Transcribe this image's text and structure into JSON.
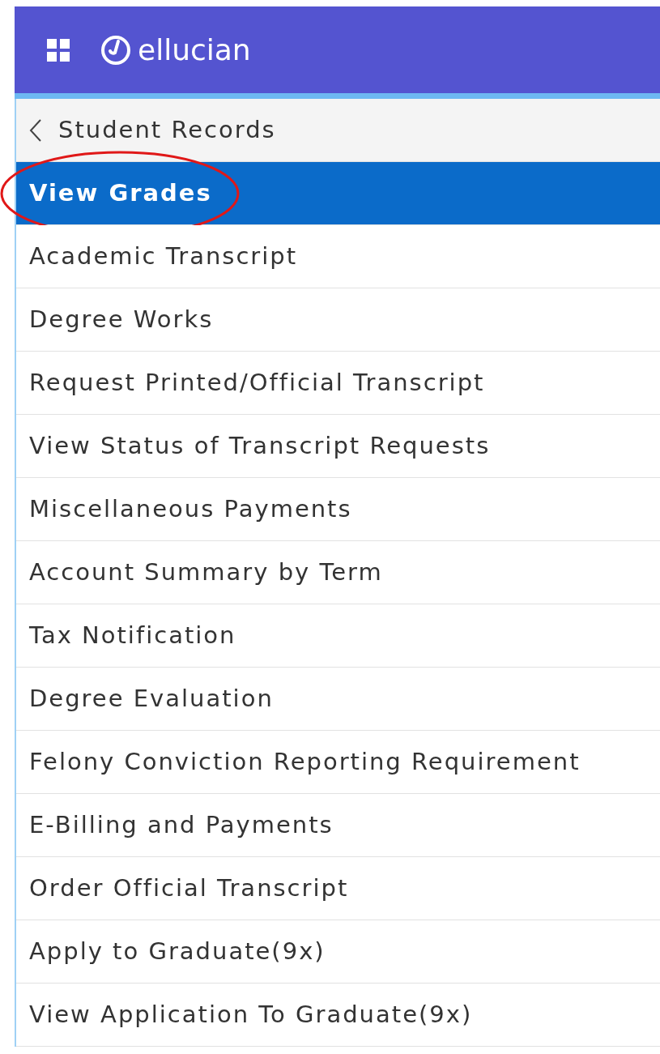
{
  "header": {
    "logo_text": "ellucian"
  },
  "menu": {
    "back_label": "Student Records",
    "items": [
      {
        "label": "View Grades",
        "selected": true,
        "highlighted": true
      },
      {
        "label": "Academic Transcript",
        "selected": false,
        "highlighted": false
      },
      {
        "label": "Degree Works",
        "selected": false,
        "highlighted": false
      },
      {
        "label": "Request Printed/Official Transcript",
        "selected": false,
        "highlighted": false
      },
      {
        "label": "View Status of Transcript Requests",
        "selected": false,
        "highlighted": false
      },
      {
        "label": "Miscellaneous Payments",
        "selected": false,
        "highlighted": false
      },
      {
        "label": "Account Summary by Term",
        "selected": false,
        "highlighted": false
      },
      {
        "label": "Tax Notification",
        "selected": false,
        "highlighted": false
      },
      {
        "label": "Degree Evaluation",
        "selected": false,
        "highlighted": false
      },
      {
        "label": "Felony Conviction Reporting Requirement",
        "selected": false,
        "highlighted": false
      },
      {
        "label": "E-Billing and Payments",
        "selected": false,
        "highlighted": false
      },
      {
        "label": "Order Official Transcript",
        "selected": false,
        "highlighted": false
      },
      {
        "label": "Apply to Graduate(9x)",
        "selected": false,
        "highlighted": false
      },
      {
        "label": "View Application To Graduate(9x)",
        "selected": false,
        "highlighted": false
      }
    ]
  }
}
